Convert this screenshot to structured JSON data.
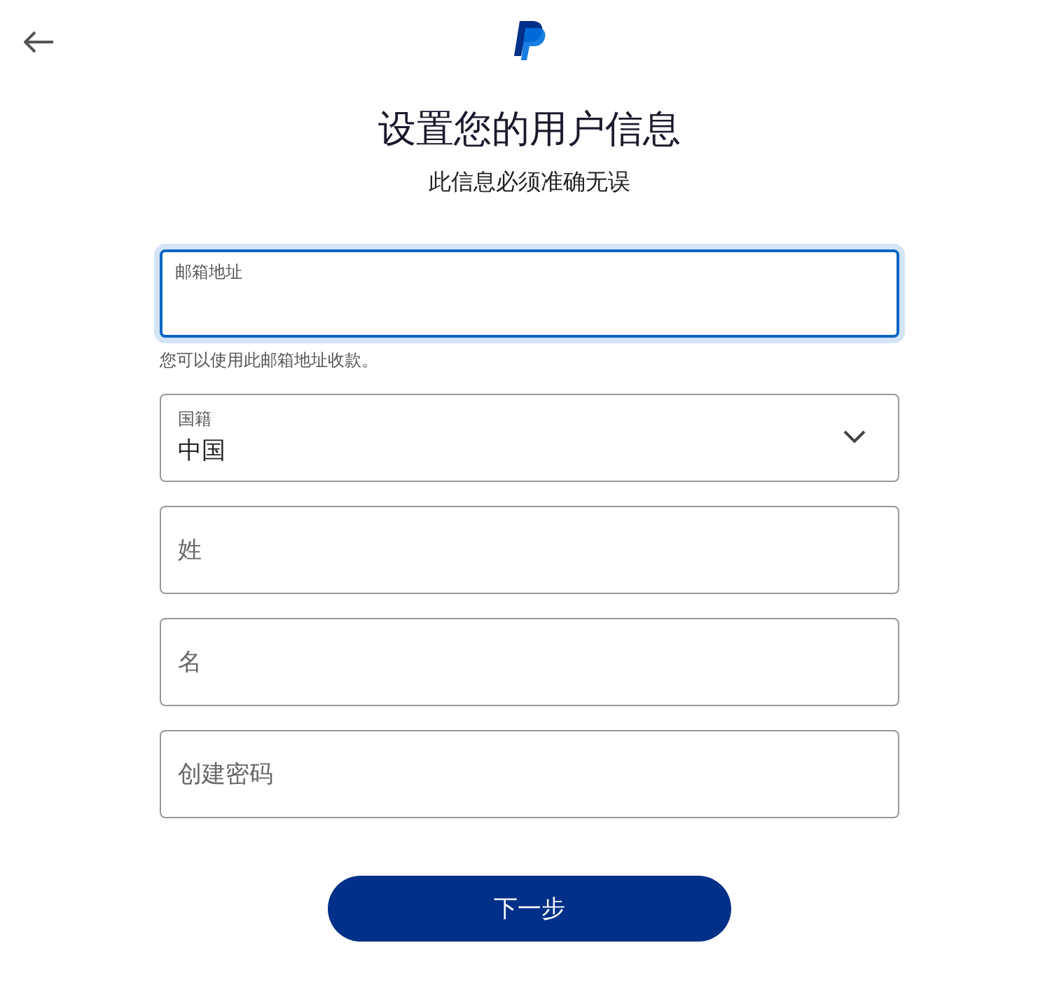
{
  "header": {
    "title": "设置您的用户信息",
    "subtitle": "此信息必须准确无误"
  },
  "fields": [
    {
      "kind": "text",
      "label": "邮箱地址",
      "focused": true,
      "helper": "您可以使用此邮箱地址收款。"
    },
    {
      "kind": "select",
      "label": "国籍",
      "value": "中国",
      "focused": false
    },
    {
      "kind": "text",
      "placeholder": "姓",
      "focused": false
    },
    {
      "kind": "text",
      "placeholder": "名",
      "focused": false
    },
    {
      "kind": "password",
      "placeholder": "创建密码",
      "focused": false
    }
  ],
  "next_button": "下一步"
}
